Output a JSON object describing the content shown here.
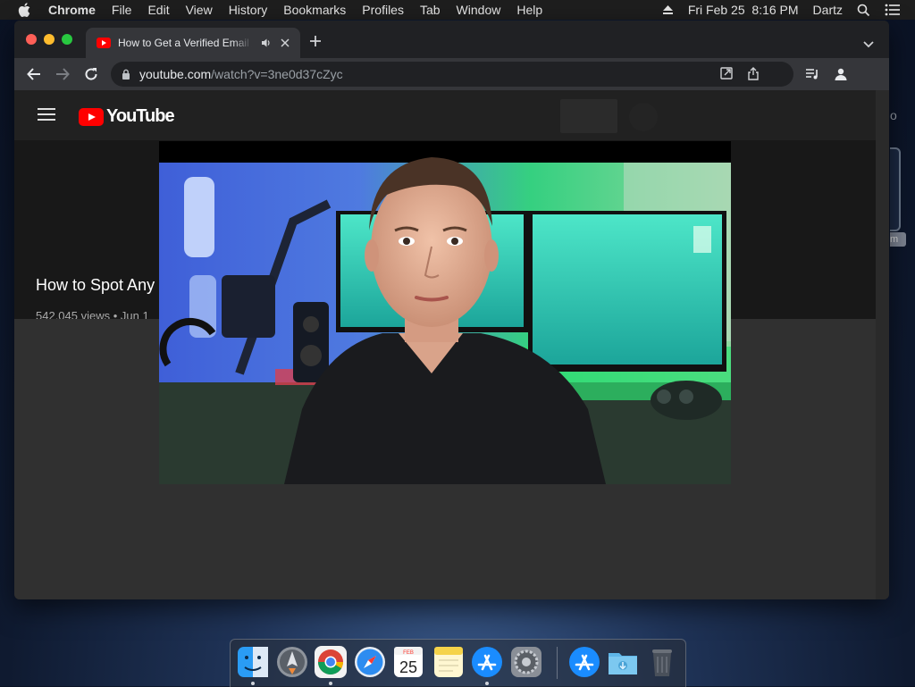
{
  "menubar": {
    "app_name": "Chrome",
    "items": [
      "File",
      "Edit",
      "View",
      "History",
      "Bookmarks",
      "Profiles",
      "Tab",
      "Window",
      "Help"
    ],
    "datetime": "Fri Feb 25  8:16 PM",
    "user": "Dartz"
  },
  "desktop": {
    "side_label": "m",
    "side_letter": "o"
  },
  "browser": {
    "tab": {
      "title": "How to Get a Verified Email Address",
      "icon": "youtube-favicon"
    },
    "address": {
      "host": "youtube.com",
      "path": "/watch?v=3ne0d37cZyc"
    }
  },
  "youtube": {
    "logo_text": "YouTube",
    "video_title": "How to Spot Any",
    "video_meta": "542,045 views • Jun 1"
  },
  "dock": {
    "items": [
      "Finder",
      "Launchpad",
      "Google Chrome",
      "Safari",
      "Calendar",
      "Notes",
      "App Store",
      "System Preferences",
      "App Store",
      "Downloads",
      "Trash"
    ],
    "calendar_month": "FEB",
    "calendar_day": "25"
  },
  "colors": {
    "youtube_red": "#ff0000",
    "page_bg": "#181818",
    "chrome_toolbar": "#35363a"
  }
}
